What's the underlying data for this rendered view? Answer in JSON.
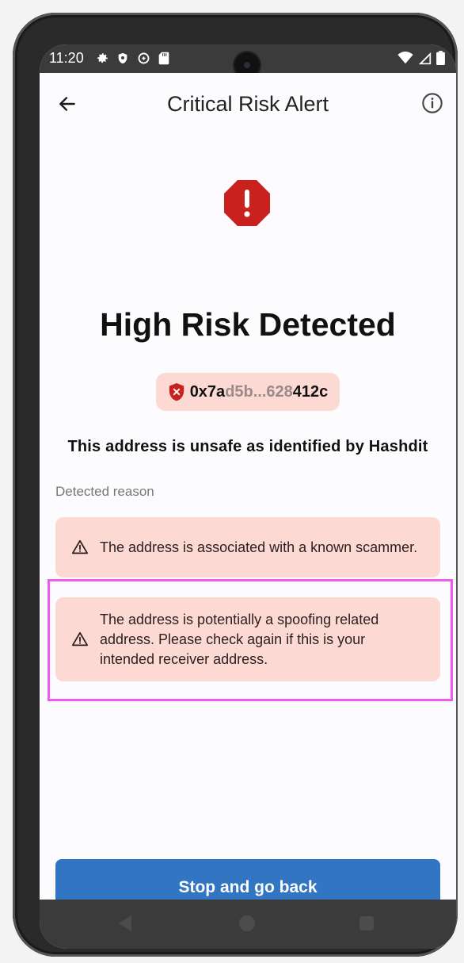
{
  "status_bar": {
    "time": "11:20",
    "left_icons": [
      "gear-icon",
      "shield-icon",
      "data-saver-icon",
      "sd-card-icon"
    ],
    "right_icons": [
      "wifi-icon",
      "signal-icon",
      "battery-icon"
    ]
  },
  "top_bar": {
    "title": "Critical Risk Alert",
    "back_icon": "arrow-left-icon",
    "info_icon": "info-icon"
  },
  "alert": {
    "icon": "stop-octagon-icon",
    "headline": "High Risk Detected",
    "address_prefix": "0x7a",
    "address_middle": "d5b...628",
    "address_suffix": "412c",
    "address_icon": "shield-x-icon",
    "unsafe_text": "This address is unsafe as identified by Hashdit"
  },
  "reasons": {
    "label": "Detected reason",
    "items": [
      {
        "text": "The address is associated with a known scammer.",
        "icon": "warning-icon"
      },
      {
        "text": "The address is potentially a spoofing related address. Please check again if this is your intended receiver address.",
        "icon": "warning-icon"
      }
    ]
  },
  "actions": {
    "primary_label": "Stop and go back"
  },
  "colors": {
    "accent_blue": "#3275c3",
    "danger_red": "#c9211d",
    "card_pink": "#fdd9d4",
    "highlight_magenta": "#ee5cf0"
  }
}
